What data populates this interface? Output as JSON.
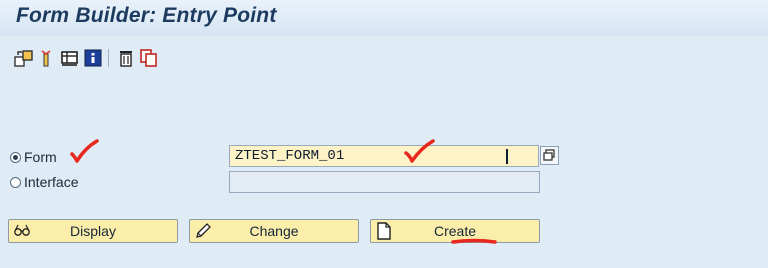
{
  "title": "Form Builder: Entry Point",
  "toolbar": {
    "icons": [
      "copy-object-icon",
      "rename-icon",
      "form-print-icon",
      "info-icon",
      "delete-icon",
      "copy-icon"
    ]
  },
  "form_radio": {
    "label": "Form",
    "selected": true
  },
  "interface_radio": {
    "label": "Interface",
    "selected": false
  },
  "form_field": {
    "value": "ZTEST_FORM_01"
  },
  "interface_field": {
    "value": ""
  },
  "buttons": {
    "display": "Display",
    "change": "Change",
    "create": "Create"
  },
  "colors": {
    "background": "#dfebf5",
    "title": "#1c3b5e",
    "input_field": "#fdf3c7",
    "button": "#fbeeaa",
    "annotation": "#e8281e"
  }
}
